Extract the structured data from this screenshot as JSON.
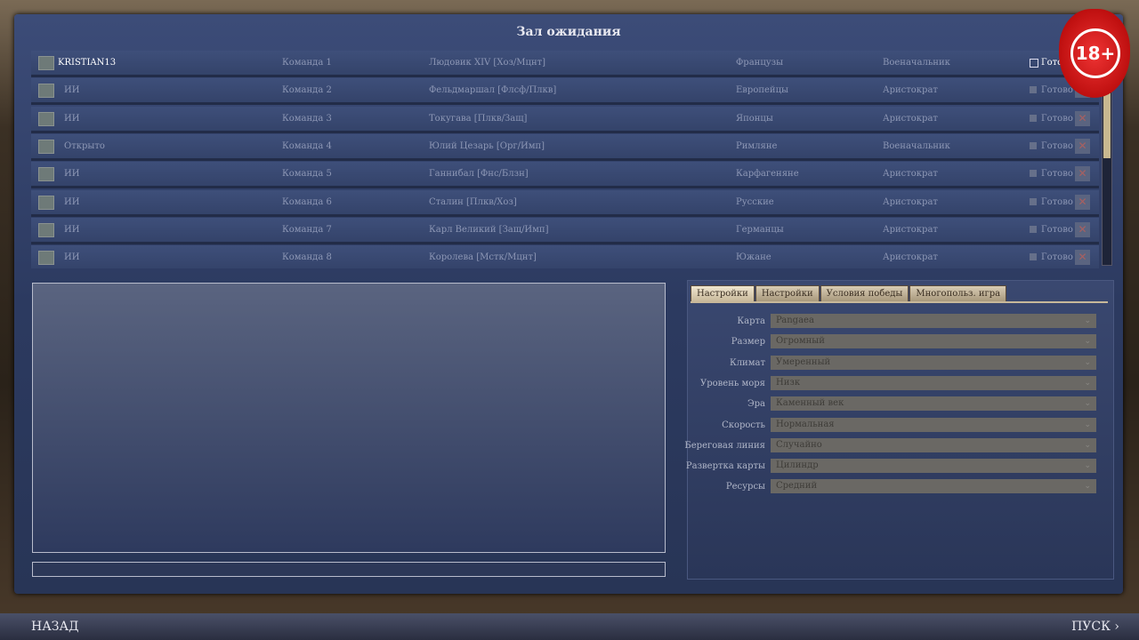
{
  "window": {
    "title": "Зал ожидания"
  },
  "players": [
    {
      "name": "KRISTIAN13",
      "team": "Команда 1",
      "leader": "Людовик XIV [Хоз/Мцнт]",
      "civ": "Французы",
      "handicap": "Военачальник",
      "ready": "Готово"
    },
    {
      "name": "ИИ",
      "team": "Команда 2",
      "leader": "Фельдмаршал [Флсф/Плкв]",
      "civ": "Европейцы",
      "handicap": "Аристократ",
      "ready": "Готово"
    },
    {
      "name": "ИИ",
      "team": "Команда 3",
      "leader": "Токугава [Плкв/Защ]",
      "civ": "Японцы",
      "handicap": "Аристократ",
      "ready": "Готово"
    },
    {
      "name": "Открыто",
      "team": "Команда 4",
      "leader": "Юлий Цезарь [Орг/Имп]",
      "civ": "Римляне",
      "handicap": "Военачальник",
      "ready": "Готово"
    },
    {
      "name": "ИИ",
      "team": "Команда 5",
      "leader": "Ганнибал [Фнс/Блзн]",
      "civ": "Карфагеняне",
      "handicap": "Аристократ",
      "ready": "Готово"
    },
    {
      "name": "ИИ",
      "team": "Команда 6",
      "leader": "Сталин [Плкв/Хоз]",
      "civ": "Русские",
      "handicap": "Аристократ",
      "ready": "Готово"
    },
    {
      "name": "ИИ",
      "team": "Команда 7",
      "leader": "Карл Великий [Защ/Имп]",
      "civ": "Германцы",
      "handicap": "Аристократ",
      "ready": "Готово"
    },
    {
      "name": "ИИ",
      "team": "Команда 8",
      "leader": "Королева [Мстк/Мцнт]",
      "civ": "Южане",
      "handicap": "Аристократ",
      "ready": "Готово"
    }
  ],
  "tabs": [
    "Настройки",
    "Настройки",
    "Условия победы",
    "Многопольз. игра"
  ],
  "settings": [
    {
      "label": "Карта",
      "value": "Pangaea"
    },
    {
      "label": "Размер",
      "value": "Огромный"
    },
    {
      "label": "Климат",
      "value": "Умеренный"
    },
    {
      "label": "Уровень моря",
      "value": "Низк"
    },
    {
      "label": "Эра",
      "value": "Каменный век"
    },
    {
      "label": "Скорость",
      "value": "Нормальная"
    },
    {
      "label": "Береговая линия",
      "value": "Случайно"
    },
    {
      "label": "Развертка карты",
      "value": "Цилиндр"
    },
    {
      "label": "Ресурсы",
      "value": "Средний"
    }
  ],
  "footer": {
    "back": "НАЗАД",
    "start": "ПУСК"
  },
  "badge": {
    "text": "18+"
  }
}
